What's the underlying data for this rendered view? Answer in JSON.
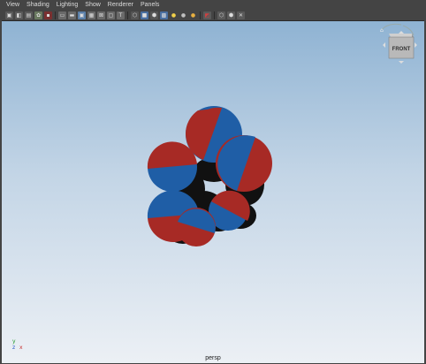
{
  "menu": [
    "View",
    "Shading",
    "Lighting",
    "Show",
    "Renderer",
    "Panels"
  ],
  "toolbar_icons": [
    "select-camera-icon",
    "camera-attributes-icon",
    "bookmark-icon",
    "image-plane-icon",
    "grid-icon",
    "film-gate-icon",
    "resolution-gate-icon",
    "gate-mask-icon",
    "field-chart-icon",
    "safe-action-icon",
    "safe-title-icon",
    "wireframe-icon",
    "smooth-shade-icon",
    "wireframe-on-shaded-icon",
    "textured-icon",
    "lights-icon",
    "shadows-icon",
    "ambient-occlusion-icon",
    "isolate-select-icon",
    "xray-icon",
    "xray-active-icon",
    "xray-joints-icon"
  ],
  "viewcube": {
    "face_label": "FRONT"
  },
  "axis": {
    "y": "y",
    "z": "z",
    "x": "x"
  },
  "camera_label": "persp",
  "colors": {
    "red": "#a72a25",
    "blue": "#1f5ea6",
    "shadow": "#0d0d0d"
  }
}
